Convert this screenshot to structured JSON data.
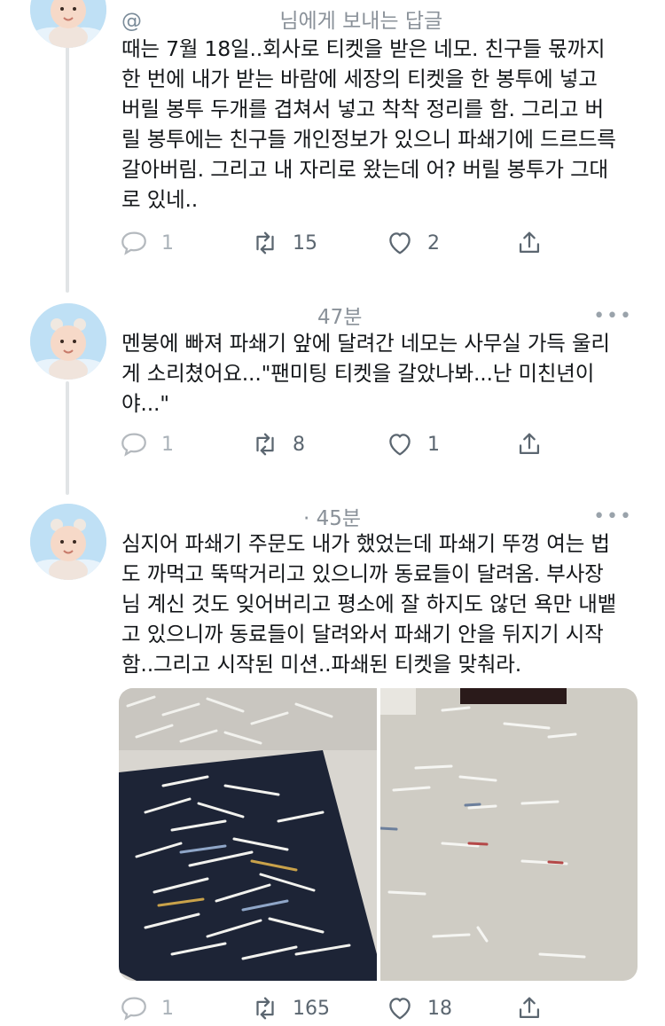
{
  "tweets": [
    {
      "handle": "@",
      "time": "",
      "header_note": "님에게 보내는 답글",
      "text": "때는 7월 18일..회사로 티켓을 받은 네모. 친구들 몫까지\n한 번에 내가 받는 바람에 세장의 티켓을 한 봉투에 넣고\n버릴 봉투 두개를 겹쳐서 넣고 착착 정리를 함. 그리고 버\n릴 봉투에는 친구들 개인정보가 있으니 파쇄기에 드르드륵\n갈아버림. 그리고 내 자리로 왔는데 어? 버릴 봉투가 그대\n로 있네..",
      "replies": "1",
      "retweets": "15",
      "likes": "2"
    },
    {
      "time": "47분",
      "text": "멘붕에 빠져 파쇄기 앞에 달려간 네모는 사무실 가득 울리\n게 소리쳤어요...\"팬미팅 티켓을 갈았나봐...난 미친년이\n야...\"",
      "replies": "1",
      "retweets": "8",
      "likes": "1"
    },
    {
      "time": "· 45분",
      "text": "심지어 파쇄기 주문도 내가 했었는데 파쇄기 뚜껑 여는 법\n도 까먹고 뚝딱거리고 있으니까 동료들이 달려옴. 부사장\n님 계신 것도 잊어버리고 평소에 잘 하지도 않던 욕만 내뱉\n고 있으니까 동료들이 달려와서 파쇄기 안을 뒤지기 시작\n함..그리고 시작된 미션..파쇄된 티켓을 맞춰라.",
      "replies": "1",
      "retweets": "165",
      "likes": "18"
    }
  ],
  "icons": {
    "reply": "reply-icon",
    "retweet": "retweet-icon",
    "like": "heart-icon",
    "share": "share-icon",
    "more": "more-icon"
  },
  "more_glyph": "•••",
  "colors": {
    "text": "#14171a",
    "meta": "#8a9199",
    "icon": "#5b6670",
    "thread": "#e1e4e6"
  }
}
